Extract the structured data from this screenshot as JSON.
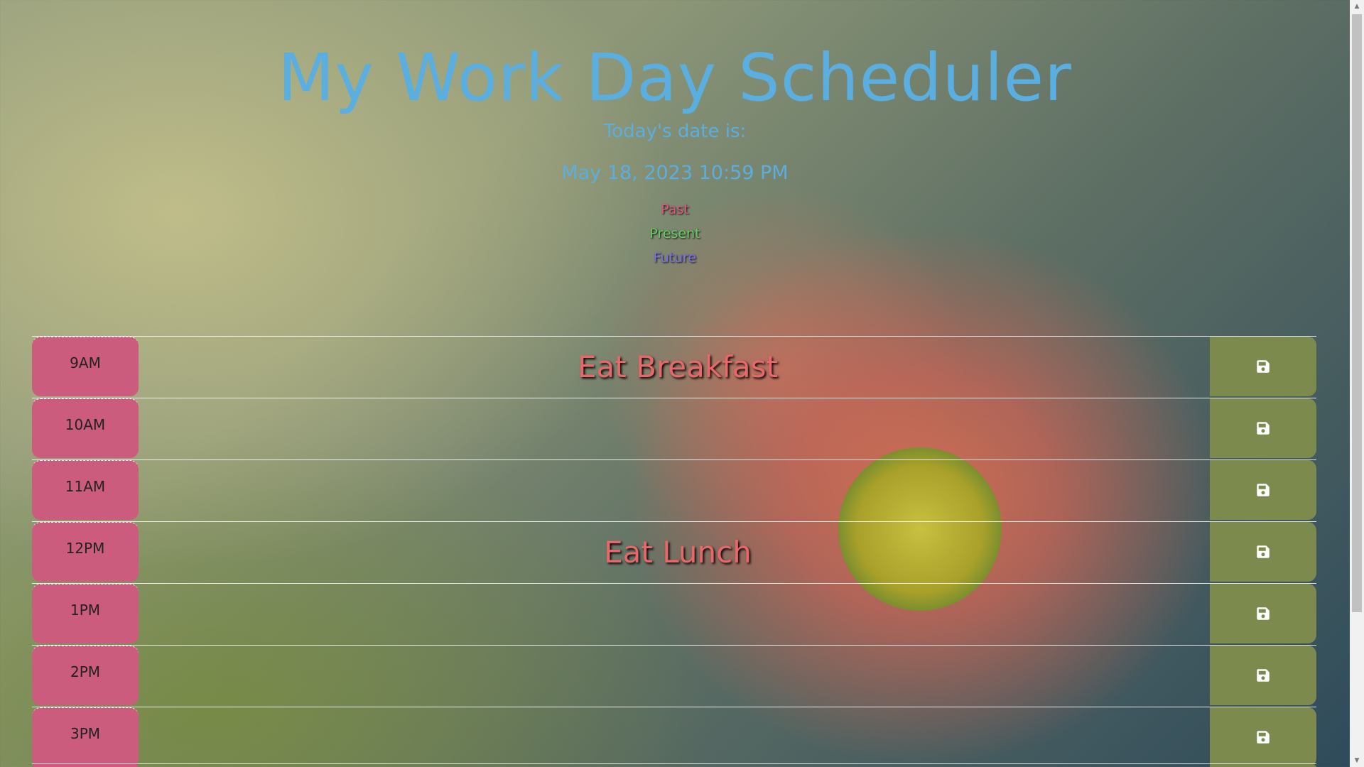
{
  "header": {
    "title": "My Work Day Scheduler",
    "date_label": "Today's date is:",
    "date_value": "May 18, 2023 10:59 PM"
  },
  "legend": {
    "past": "Past",
    "present": "Present",
    "future": "Future"
  },
  "colors": {
    "title": "#5aaee0",
    "past": "#e0587c",
    "present": "#66cc66",
    "future": "#7b72f0",
    "hour_block": "#cc5c7e",
    "save_button": "#7d8a4d",
    "task_text": "#e8676a"
  },
  "schedule": {
    "rows": [
      {
        "hour": "9AM",
        "task": "Eat Breakfast",
        "save_icon": "floppy-disk-icon"
      },
      {
        "hour": "10AM",
        "task": "",
        "save_icon": "floppy-disk-icon"
      },
      {
        "hour": "11AM",
        "task": "",
        "save_icon": "floppy-disk-icon"
      },
      {
        "hour": "12PM",
        "task": "Eat Lunch",
        "save_icon": "floppy-disk-icon"
      },
      {
        "hour": "1PM",
        "task": "",
        "save_icon": "floppy-disk-icon"
      },
      {
        "hour": "2PM",
        "task": "",
        "save_icon": "floppy-disk-icon"
      },
      {
        "hour": "3PM",
        "task": "",
        "save_icon": "floppy-disk-icon"
      }
    ]
  }
}
